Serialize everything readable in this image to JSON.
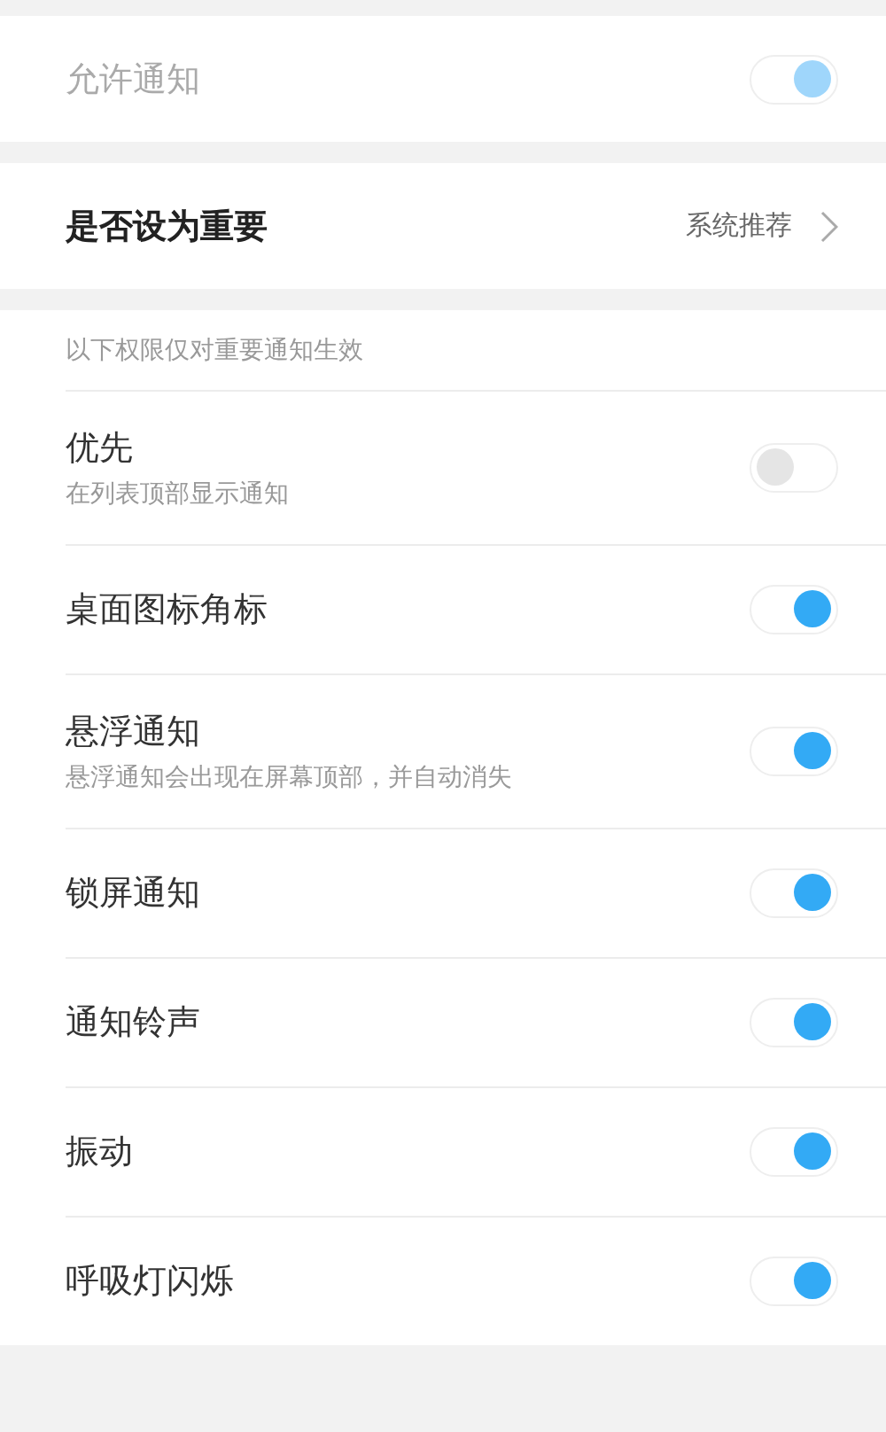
{
  "allow_notifications": {
    "label": "允许通知",
    "on": true,
    "disabled": true
  },
  "importance": {
    "label": "是否设为重要",
    "value": "系统推荐"
  },
  "section_note": "以下权限仅对重要通知生效",
  "settings": [
    {
      "label": "优先",
      "description": "在列表顶部显示通知",
      "on": false
    },
    {
      "label": "桌面图标角标",
      "on": true
    },
    {
      "label": "悬浮通知",
      "description": "悬浮通知会出现在屏幕顶部，并自动消失",
      "on": true
    },
    {
      "label": "锁屏通知",
      "on": true
    },
    {
      "label": "通知铃声",
      "on": true
    },
    {
      "label": "振动",
      "on": true
    },
    {
      "label": "呼吸灯闪烁",
      "on": true
    }
  ]
}
